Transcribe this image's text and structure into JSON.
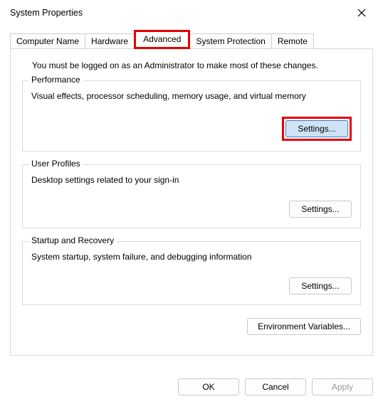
{
  "window": {
    "title": "System Properties"
  },
  "tabs": {
    "computer_name": "Computer Name",
    "hardware": "Hardware",
    "advanced": "Advanced",
    "system_protection": "System Protection",
    "remote": "Remote"
  },
  "admin_note": "You must be logged on as an Administrator to make most of these changes.",
  "performance": {
    "legend": "Performance",
    "desc": "Visual effects, processor scheduling, memory usage, and virtual memory",
    "settings_label": "Settings..."
  },
  "user_profiles": {
    "legend": "User Profiles",
    "desc": "Desktop settings related to your sign-in",
    "settings_label": "Settings..."
  },
  "startup": {
    "legend": "Startup and Recovery",
    "desc": "System startup, system failure, and debugging information",
    "settings_label": "Settings..."
  },
  "env_button": "Environment Variables...",
  "buttons": {
    "ok": "OK",
    "cancel": "Cancel",
    "apply": "Apply"
  }
}
